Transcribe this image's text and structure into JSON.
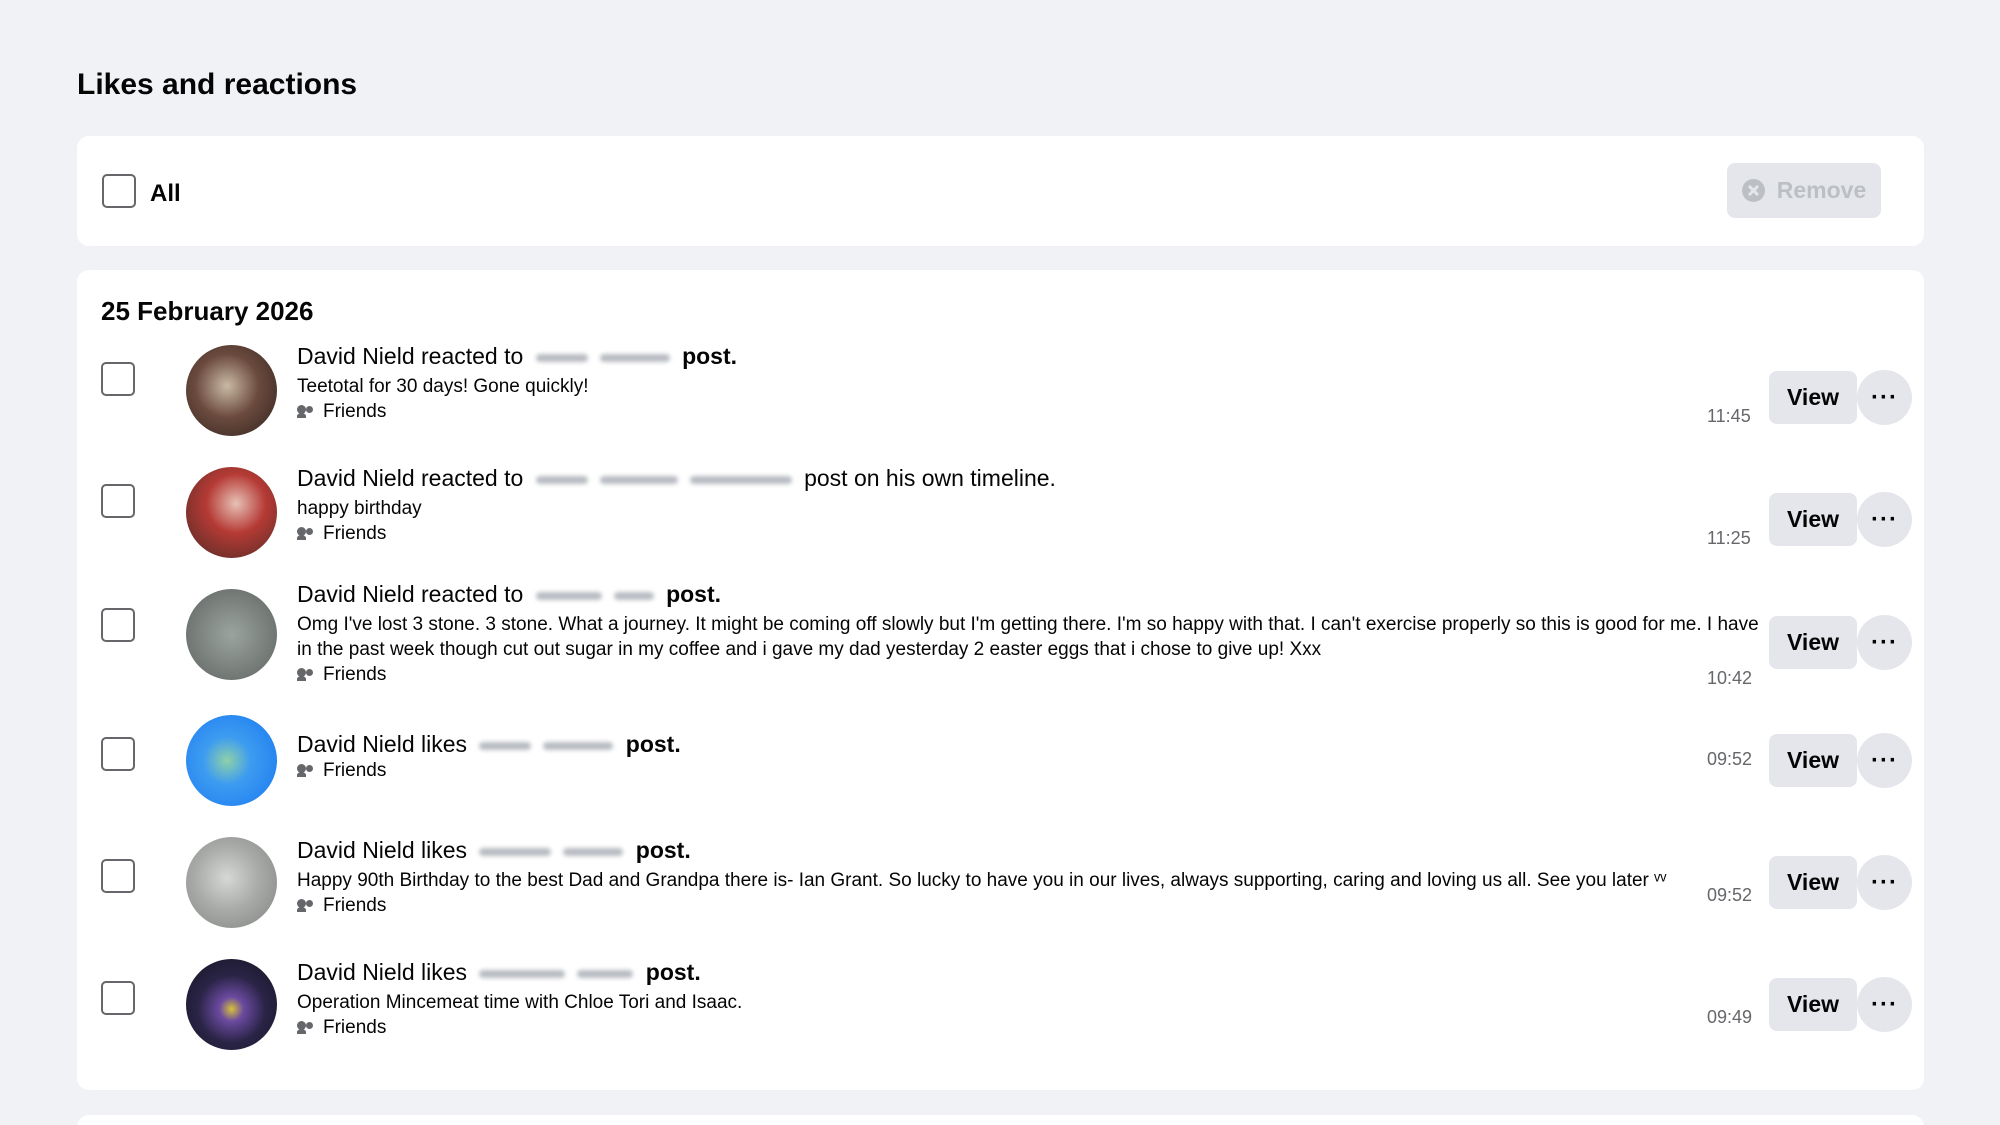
{
  "page": {
    "title": "Likes and reactions"
  },
  "toolbar": {
    "all_label": "All",
    "remove_label": "Remove"
  },
  "groups": [
    {
      "date": "25 February 2026",
      "items": [
        {
          "name": "David Nield",
          "action": "reacted to",
          "suffix": "post.",
          "suffix_bold": true,
          "desc": "Teetotal for 30 days! Gone quickly!",
          "audience": "Friends",
          "time": "11:45",
          "avatar_color": "#5a3f35"
        },
        {
          "name": "David Nield",
          "action": "reacted to",
          "suffix": "post on his own timeline.",
          "suffix_bold": false,
          "desc": "happy birthday",
          "audience": "Friends",
          "time": "11:25",
          "avatar_color": "#8a3a34"
        },
        {
          "name": "David Nield",
          "action": "reacted to",
          "suffix": "post.",
          "suffix_bold": true,
          "desc": "Omg I've lost 3 stone. 3 stone. What a journey. It might be coming off slowly but I'm getting there. I'm so happy with that. I can't exercise properly so this is good for me. I have in the past week though cut out sugar in my coffee and i gave my dad yesterday 2 easter eggs that i chose to give up! Xxx",
          "audience": "Friends",
          "time": "10:42",
          "avatar_color": "#8a918c"
        },
        {
          "name": "David Nield",
          "action": "likes",
          "suffix": "post.",
          "suffix_bold": true,
          "desc": "",
          "audience": "Friends",
          "time": "09:52",
          "avatar_color": "#2f8ef0"
        },
        {
          "name": "David Nield",
          "action": "likes",
          "suffix": "post.",
          "suffix_bold": true,
          "desc": "Happy 90th Birthday to the best Dad and Grandpa there is- Ian Grant. So lucky to have you in our lives, always supporting, caring and loving us all. See you later ᵛᵛ",
          "audience": "Friends",
          "time": "09:52",
          "avatar_color": "#a7a9a8"
        },
        {
          "name": "David Nield",
          "action": "likes",
          "suffix": "post.",
          "suffix_bold": true,
          "desc": "Operation Mincemeat time with Chloe Tori and Isaac.",
          "audience": "Friends",
          "time": "09:49",
          "avatar_color": "#1c1a2e"
        }
      ]
    }
  ],
  "buttons": {
    "view_label": "View",
    "more_label": "···"
  },
  "icons": {
    "remove": "x-circle-icon",
    "audience": "friends-icon",
    "more": "more-icon"
  }
}
